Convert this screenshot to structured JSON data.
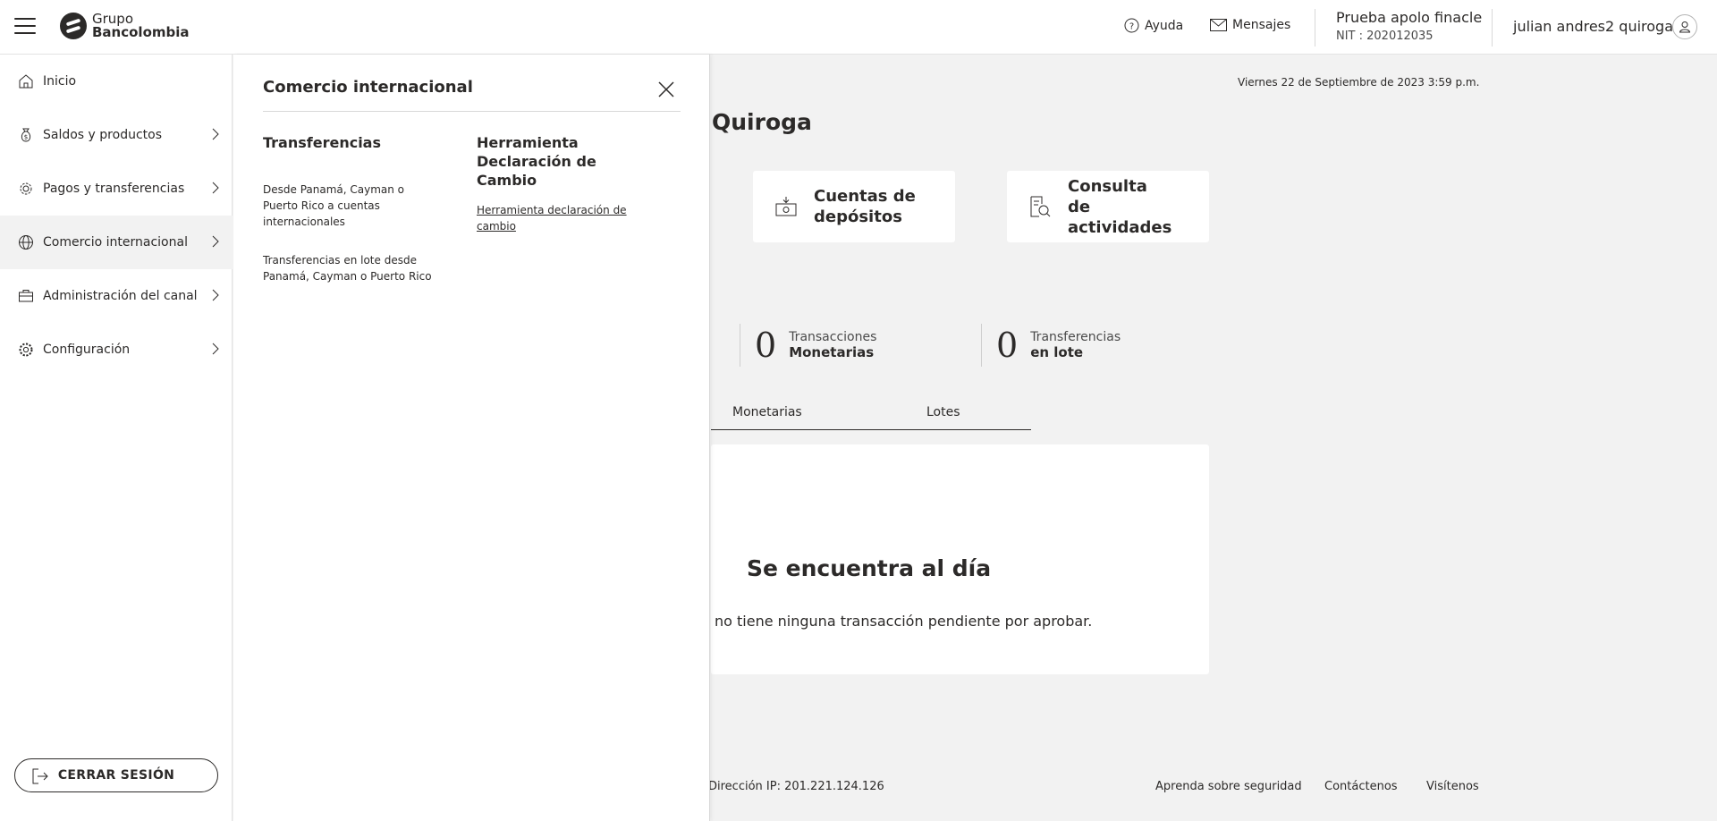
{
  "header": {
    "brand_line1": "Grupo",
    "brand_line2": "Bancolombia",
    "help_label": "Ayuda",
    "messages_label": "Mensajes",
    "company_name": "Prueba apolo finacle",
    "company_nit": "NIT : 202012035",
    "user_name": "julian andres2 quiroga"
  },
  "sidebar": {
    "items": [
      {
        "label": "Inicio",
        "icon": "home-icon"
      },
      {
        "label": "Saldos y productos",
        "icon": "money-bag-icon"
      },
      {
        "label": "Pagos y transferencias",
        "icon": "transfer-gear-icon"
      },
      {
        "label": "Comercio internacional",
        "icon": "globe-icon"
      },
      {
        "label": "Administración del canal",
        "icon": "briefcase-icon"
      },
      {
        "label": "Configuración",
        "icon": "gear-icon"
      }
    ],
    "logout_label": "CERRAR SESIÓN"
  },
  "panel": {
    "title": "Comercio internacional",
    "col1_head": "Transferencias",
    "col1_links": [
      "Desde Panamá, Cayman o Puerto Rico a cuentas internacionales",
      "Transferencias en lote desde Panamá, Cayman o Puerto Rico"
    ],
    "col2_head": "Herramienta Declaración de Cambio",
    "col2_links": [
      "Herramienta declaración de cambio"
    ]
  },
  "main": {
    "date": "Viernes 22 de Septiembre de 2023 3:59 p.m.",
    "title_visible": "Quiroga",
    "quick_links": [
      {
        "label": "Cuentas de depósitos",
        "icon": "deposit-icon"
      },
      {
        "label": "Consulta de actividades",
        "icon": "activity-search-icon"
      }
    ],
    "counters": [
      {
        "count": "0",
        "line1": "Transacciones",
        "line2": "Monetarias"
      },
      {
        "count": "0",
        "line1": "Transferencias",
        "line2": "en lote"
      }
    ],
    "tabs": [
      "Monetarias",
      "Lotes"
    ],
    "status_title": "Se encuentra al día",
    "status_desc": "no tiene ninguna transacción pendiente por aprobar."
  },
  "footer": {
    "ip": "Dirección IP: 201.221.124.126",
    "links": [
      "Aprenda sobre seguridad",
      "Contáctenos",
      "Visítenos"
    ]
  },
  "colors": {
    "text": "#2c2a29",
    "background": "#f2f2f2",
    "surface": "#ffffff"
  }
}
